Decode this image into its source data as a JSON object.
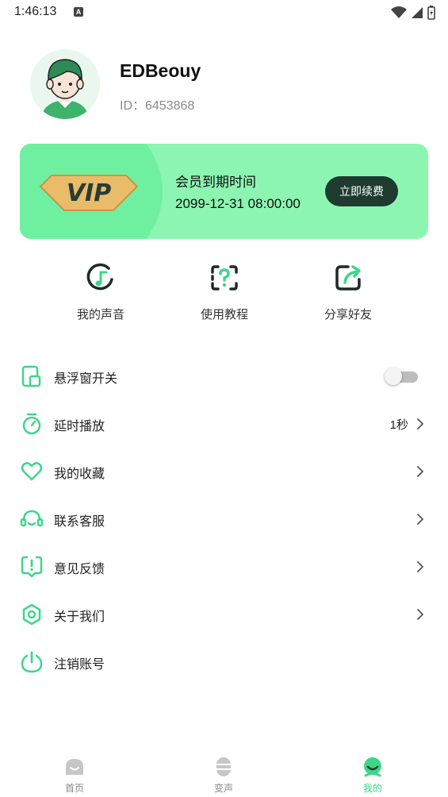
{
  "status_bar": {
    "time": "1:46:13",
    "notification_letter": "A"
  },
  "profile": {
    "username": "EDBeouy",
    "id_text": "ID：6453868"
  },
  "vip": {
    "badge_text": "VIP",
    "expire_label": "会员到期时间",
    "expire_date": "2099-12-31 08:00:00",
    "renew_label": "立即续费"
  },
  "quick_actions": [
    {
      "label": "我的声音",
      "icon": "music-note-icon"
    },
    {
      "label": "使用教程",
      "icon": "question-icon"
    },
    {
      "label": "分享好友",
      "icon": "share-icon"
    }
  ],
  "menu": [
    {
      "label": "悬浮窗开关",
      "icon": "floating-window-icon",
      "toggle_on": false
    },
    {
      "label": "延时播放",
      "icon": "timer-icon",
      "value": "1秒"
    },
    {
      "label": "我的收藏",
      "icon": "heart-icon"
    },
    {
      "label": "联系客服",
      "icon": "headset-icon"
    },
    {
      "label": "意见反馈",
      "icon": "feedback-icon"
    },
    {
      "label": "关于我们",
      "icon": "hexagon-icon"
    },
    {
      "label": "注销账号",
      "icon": "power-icon"
    }
  ],
  "bottom_nav": [
    {
      "label": "首页",
      "icon": "home-icon",
      "active": false
    },
    {
      "label": "变声",
      "icon": "voice-change-icon",
      "active": false
    },
    {
      "label": "我的",
      "icon": "mine-icon",
      "active": true
    }
  ],
  "colors": {
    "accent": "#3fd68a",
    "vip_card": "#8cf5b2",
    "renew_button": "#1f3b30"
  }
}
